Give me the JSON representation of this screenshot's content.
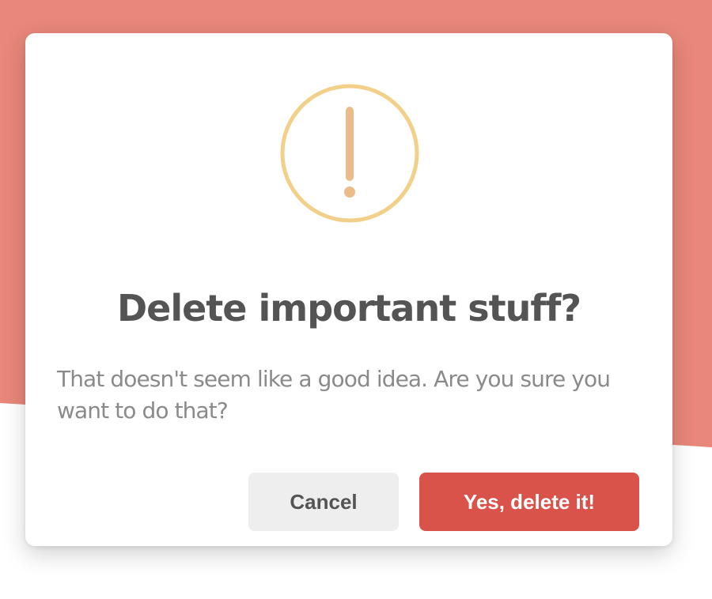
{
  "colors": {
    "backdrop": "#e8877a",
    "page": "#ffffff",
    "warning_ring": "#f2d08a",
    "warning_mark": "#ecbb8a",
    "confirm_button": "#d9534b",
    "cancel_button": "#eeeeee"
  },
  "dialog": {
    "icon": "exclamation-warning-icon",
    "title": "Delete important stuff?",
    "message": "That doesn't seem like a good idea. Are you sure you want to do that?",
    "cancel_label": "Cancel",
    "confirm_label": "Yes, delete it!"
  }
}
